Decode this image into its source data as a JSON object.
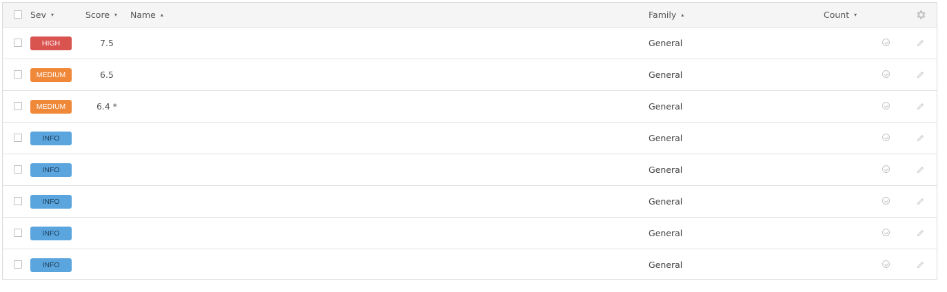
{
  "header": {
    "sev_label": "Sev",
    "score_label": "Score",
    "name_label": "Name",
    "family_label": "Family",
    "count_label": "Count",
    "sev_sort": "▾",
    "score_sort": "▾",
    "name_sort": "▴",
    "family_sort": "▴",
    "count_sort": "▾"
  },
  "rows": [
    {
      "severity": "HIGH",
      "score": "7.5",
      "family": "General"
    },
    {
      "severity": "MEDIUM",
      "score": "6.5",
      "family": "General"
    },
    {
      "severity": "MEDIUM",
      "score": "6.4 *",
      "family": "General"
    },
    {
      "severity": "INFO",
      "score": "",
      "family": "General"
    },
    {
      "severity": "INFO",
      "score": "",
      "family": "General"
    },
    {
      "severity": "INFO",
      "score": "",
      "family": "General"
    },
    {
      "severity": "INFO",
      "score": "",
      "family": "General"
    },
    {
      "severity": "INFO",
      "score": "",
      "family": "General"
    }
  ],
  "colors": {
    "high": "#d9534f",
    "medium": "#f0883a",
    "info": "#5aa5de",
    "header_bg": "#f5f5f5",
    "border": "#d9d9d9"
  },
  "icons": {
    "row_status": "check-circle-icon",
    "row_edit": "pencil-icon",
    "settings": "gear-icon"
  }
}
